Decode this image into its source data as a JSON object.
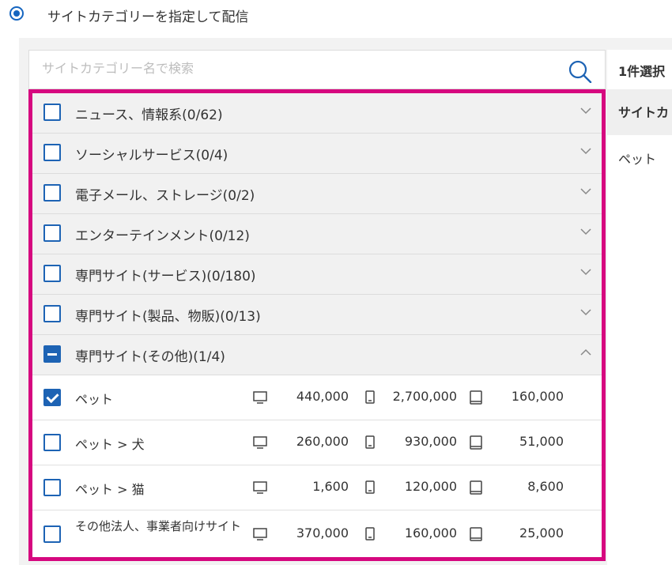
{
  "radio_option": {
    "label": "サイトカテゴリーを指定して配信",
    "selected": true
  },
  "search": {
    "placeholder": "サイトカテゴリー名で検索",
    "value": ""
  },
  "selection_panel": {
    "count_label": "1件選択",
    "column_header": "サイトカ",
    "selected_items": [
      "ペット"
    ]
  },
  "categories": [
    {
      "label": "ニュース、情報系(0/62)",
      "state": "unchecked",
      "expanded": false
    },
    {
      "label": "ソーシャルサービス(0/4)",
      "state": "unchecked",
      "expanded": false
    },
    {
      "label": "電子メール、ストレージ(0/2)",
      "state": "unchecked",
      "expanded": false
    },
    {
      "label": "エンターテインメント(0/12)",
      "state": "unchecked",
      "expanded": false
    },
    {
      "label": "専門サイト(サービス)(0/180)",
      "state": "unchecked",
      "expanded": false
    },
    {
      "label": "専門サイト(製品、物販)(0/13)",
      "state": "unchecked",
      "expanded": false
    },
    {
      "label": "専門サイト(その他)(1/4)",
      "state": "partial",
      "expanded": true
    }
  ],
  "subcategories": [
    {
      "label": "ペット",
      "checked": true,
      "desktop": "440,000",
      "mobile": "2,700,000",
      "tablet": "160,000"
    },
    {
      "label": "ペット > 犬",
      "checked": false,
      "desktop": "260,000",
      "mobile": "930,000",
      "tablet": "51,000"
    },
    {
      "label": "ペット > 猫",
      "checked": false,
      "desktop": "1,600",
      "mobile": "120,000",
      "tablet": "8,600"
    },
    {
      "label": "その他法人、事業者向けサイト",
      "checked": false,
      "desktop": "370,000",
      "mobile": "160,000",
      "tablet": "25,000"
    }
  ],
  "device_icons": [
    "desktop-icon",
    "mobile-icon",
    "tablet-icon"
  ],
  "colors": {
    "accent": "#1d63b4",
    "highlight_border": "#d6087f",
    "category_bg": "#f1f1f1",
    "panel_bg": "#f2f2f2"
  }
}
